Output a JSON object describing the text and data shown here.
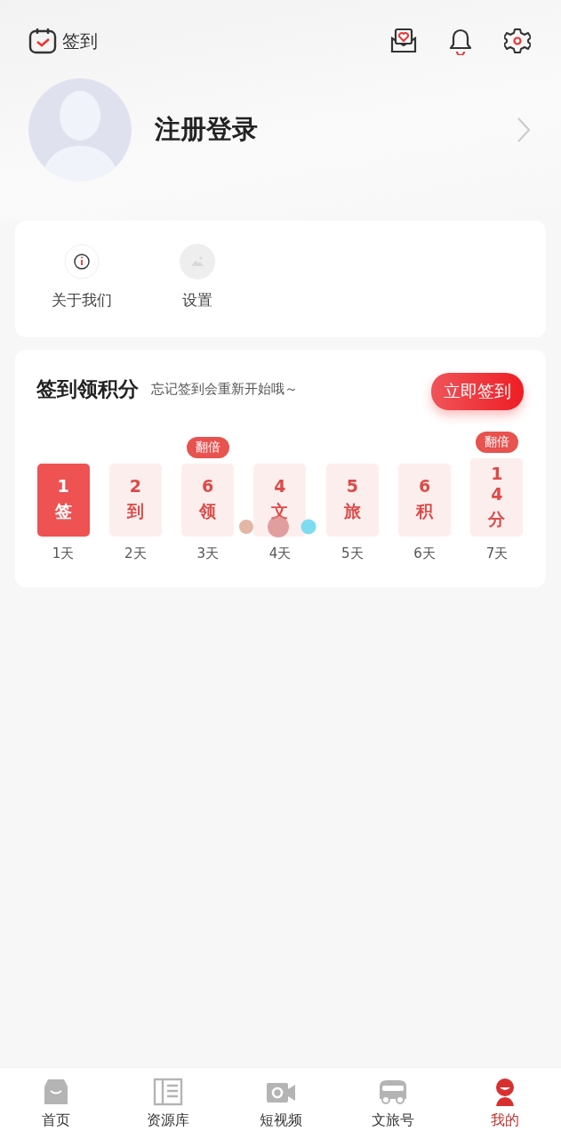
{
  "header": {
    "checkin_label": "签到",
    "login_label": "注册登录"
  },
  "shortcuts": [
    {
      "kind": "info",
      "label": "关于我们"
    },
    {
      "kind": "image",
      "label": "设置"
    }
  ],
  "checkin": {
    "title": "签到领积分",
    "subtitle": "忘记签到会重新开始哦～",
    "button": "立即签到",
    "days": [
      {
        "points": "1",
        "char": "签",
        "day": "1天",
        "selected": true
      },
      {
        "points": "2",
        "char": "到",
        "day": "2天",
        "selected": false
      },
      {
        "points": "6",
        "char": "领",
        "day": "3天",
        "selected": false,
        "badge": "翻倍"
      },
      {
        "points": "4",
        "char": "文",
        "day": "4天",
        "selected": false
      },
      {
        "points": "5",
        "char": "旅",
        "day": "5天",
        "selected": false
      },
      {
        "points": "6",
        "char": "积",
        "day": "6天",
        "selected": false
      },
      {
        "points": "14",
        "char": "分",
        "day": "7天",
        "selected": false,
        "badge": "翻倍"
      }
    ]
  },
  "tabs": [
    {
      "kind": "home",
      "label": "首页",
      "selected": false
    },
    {
      "kind": "library",
      "label": "资源库",
      "selected": false
    },
    {
      "kind": "video",
      "label": "短视频",
      "selected": false
    },
    {
      "kind": "bus",
      "label": "文旅号",
      "selected": false
    },
    {
      "kind": "me",
      "label": "我的",
      "selected": true
    }
  ]
}
